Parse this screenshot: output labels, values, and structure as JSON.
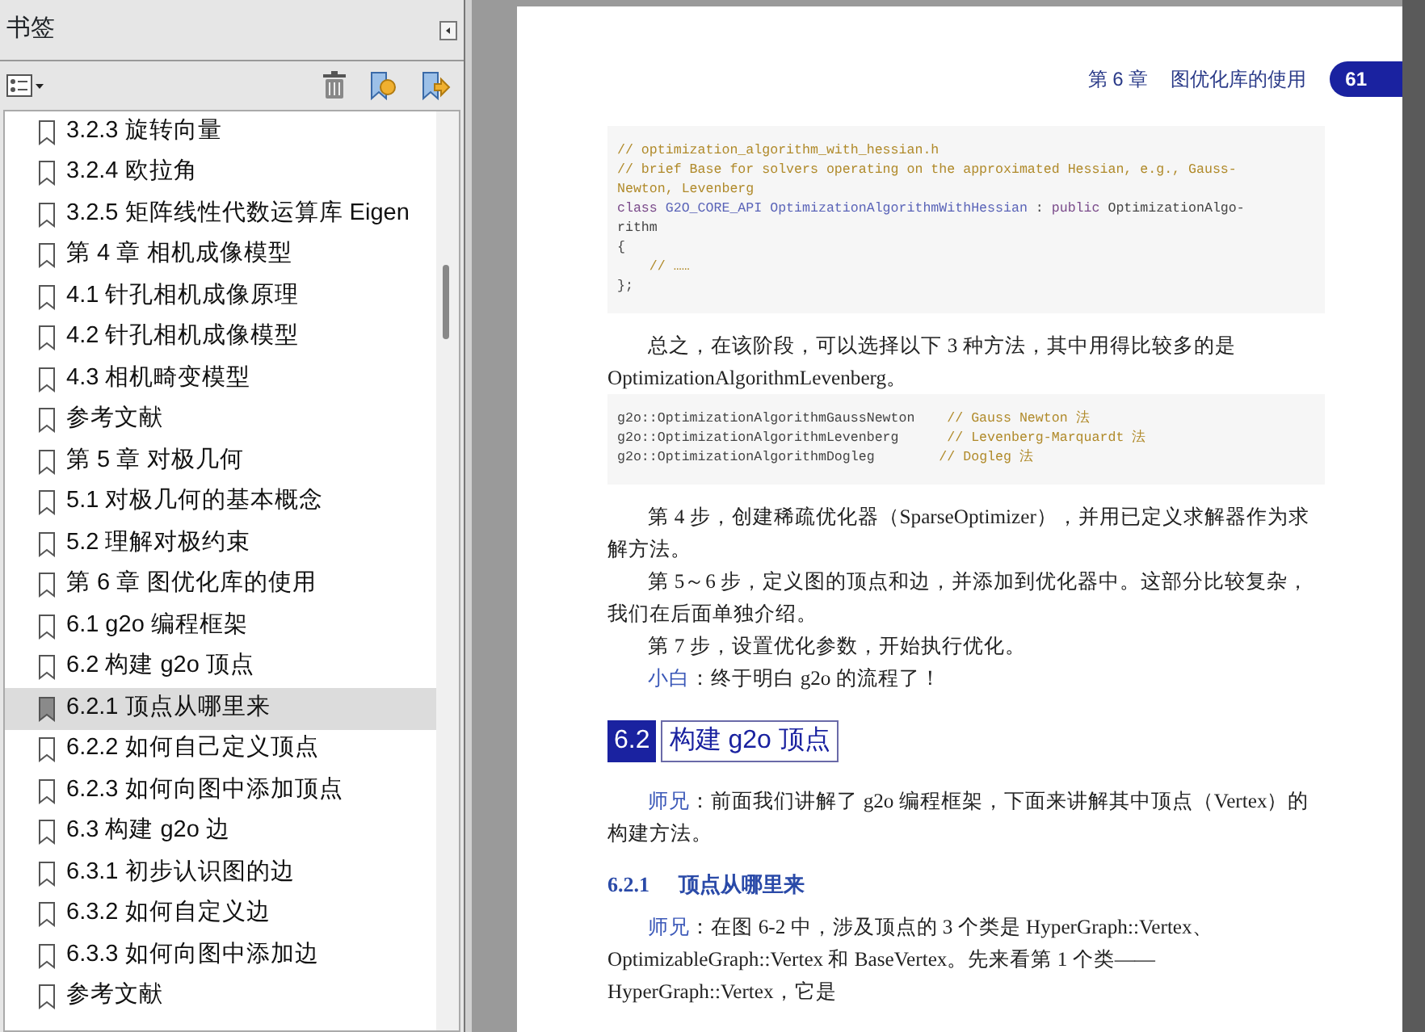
{
  "sidebar": {
    "title": "书签",
    "items": [
      {
        "label": "3.2.3 旋转向量",
        "selected": false
      },
      {
        "label": "3.2.4 欧拉角",
        "selected": false
      },
      {
        "label": "3.2.5 矩阵线性代数运算库 Eigen",
        "selected": false
      },
      {
        "label": "第 4 章 相机成像模型",
        "selected": false
      },
      {
        "label": "4.1 针孔相机成像原理",
        "selected": false
      },
      {
        "label": "4.2 针孔相机成像模型",
        "selected": false
      },
      {
        "label": "4.3 相机畸变模型",
        "selected": false
      },
      {
        "label": "参考文献",
        "selected": false
      },
      {
        "label": "第 5 章 对极几何",
        "selected": false
      },
      {
        "label": "5.1 对极几何的基本概念",
        "selected": false
      },
      {
        "label": "5.2 理解对极约束",
        "selected": false
      },
      {
        "label": "第 6 章 图优化库的使用",
        "selected": false
      },
      {
        "label": "6.1 g2o 编程框架",
        "selected": false
      },
      {
        "label": "6.2 构建 g2o 顶点",
        "selected": false
      },
      {
        "label": "6.2.1 顶点从哪里来",
        "selected": true
      },
      {
        "label": "6.2.2 如何自己定义顶点",
        "selected": false
      },
      {
        "label": "6.2.3 如何向图中添加顶点",
        "selected": false
      },
      {
        "label": "6.3 构建 g2o 边",
        "selected": false
      },
      {
        "label": "6.3.1 初步认识图的边",
        "selected": false
      },
      {
        "label": "6.3.2 如何自定义边",
        "selected": false
      },
      {
        "label": "6.3.3 如何向图中添加边",
        "selected": false
      },
      {
        "label": "参考文献",
        "selected": false
      }
    ]
  },
  "page": {
    "header": {
      "chapter": "第 6 章",
      "title": "图优化库的使用",
      "page_number": "61"
    },
    "blocks": [
      {
        "kind": "code",
        "lines": [
          [
            {
              "kind": "comment",
              "text": "// optimization_algorithm_with_hessian.h"
            }
          ],
          [
            {
              "kind": "comment",
              "text": "// brief Base for solvers operating on the approximated Hessian, e.g., Gauss-"
            }
          ],
          [
            {
              "kind": "comment",
              "text": "Newton, Levenberg"
            }
          ],
          [
            {
              "kind": "keyword",
              "text": "class "
            },
            {
              "kind": "type",
              "text": "G2O_CORE_API OptimizationAlgorithmWithHessian"
            },
            {
              "kind": "plain",
              "text": " : "
            },
            {
              "kind": "keyword",
              "text": "public"
            },
            {
              "kind": "plain",
              "text": " OptimizationAlgo-"
            }
          ],
          [
            {
              "kind": "plain",
              "text": "rithm"
            }
          ],
          [
            {
              "kind": "plain",
              "text": "{"
            }
          ],
          [
            {
              "kind": "comment",
              "text": "    // ……"
            }
          ],
          [
            {
              "kind": "plain",
              "text": "};"
            }
          ]
        ]
      },
      {
        "kind": "para",
        "text": "总之，在该阶段，可以选择以下 3 种方法，其中用得比较多的是 OptimizationAlgorithmLevenberg。"
      },
      {
        "kind": "code",
        "lines": [
          [
            {
              "kind": "plain",
              "text": "g2o::OptimizationAlgorithmGaussNewton    "
            },
            {
              "kind": "comment",
              "text": "// Gauss Newton 法"
            }
          ],
          [
            {
              "kind": "plain",
              "text": "g2o::OptimizationAlgorithmLevenberg      "
            },
            {
              "kind": "comment",
              "text": "// Levenberg-Marquardt 法"
            }
          ],
          [
            {
              "kind": "plain",
              "text": "g2o::OptimizationAlgorithmDogleg        "
            },
            {
              "kind": "comment",
              "text": "// Dogleg 法"
            }
          ]
        ]
      },
      {
        "kind": "para",
        "text": "第 4 步，创建稀疏优化器（SparseOptimizer），并用已定义求解器作为求解方法。"
      },
      {
        "kind": "para",
        "text": "第 5～6 步，定义图的顶点和边，并添加到优化器中。这部分比较复杂，我们在后面单独介绍。"
      },
      {
        "kind": "para",
        "text": "第 7 步，设置优化参数，开始执行优化。"
      },
      {
        "kind": "para",
        "speaker": "小白",
        "text": "：终于明白 g2o 的流程了！"
      },
      {
        "kind": "section",
        "number": "6.2",
        "text": "构建 g2o 顶点"
      },
      {
        "kind": "para",
        "speaker": "师兄",
        "text": "：前面我们讲解了 g2o 编程框架，下面来讲解其中顶点（Vertex）的构建方法。"
      },
      {
        "kind": "subsection",
        "number": "6.2.1",
        "text": "顶点从哪里来"
      },
      {
        "kind": "para",
        "speaker": "师兄",
        "text": "：在图 6-2 中，涉及顶点的 3 个类是 HyperGraph::Vertex、OptimizableGraph::Vertex 和 BaseVertex。先来看第 1 个类——HyperGraph::Vertex，它是"
      }
    ]
  }
}
